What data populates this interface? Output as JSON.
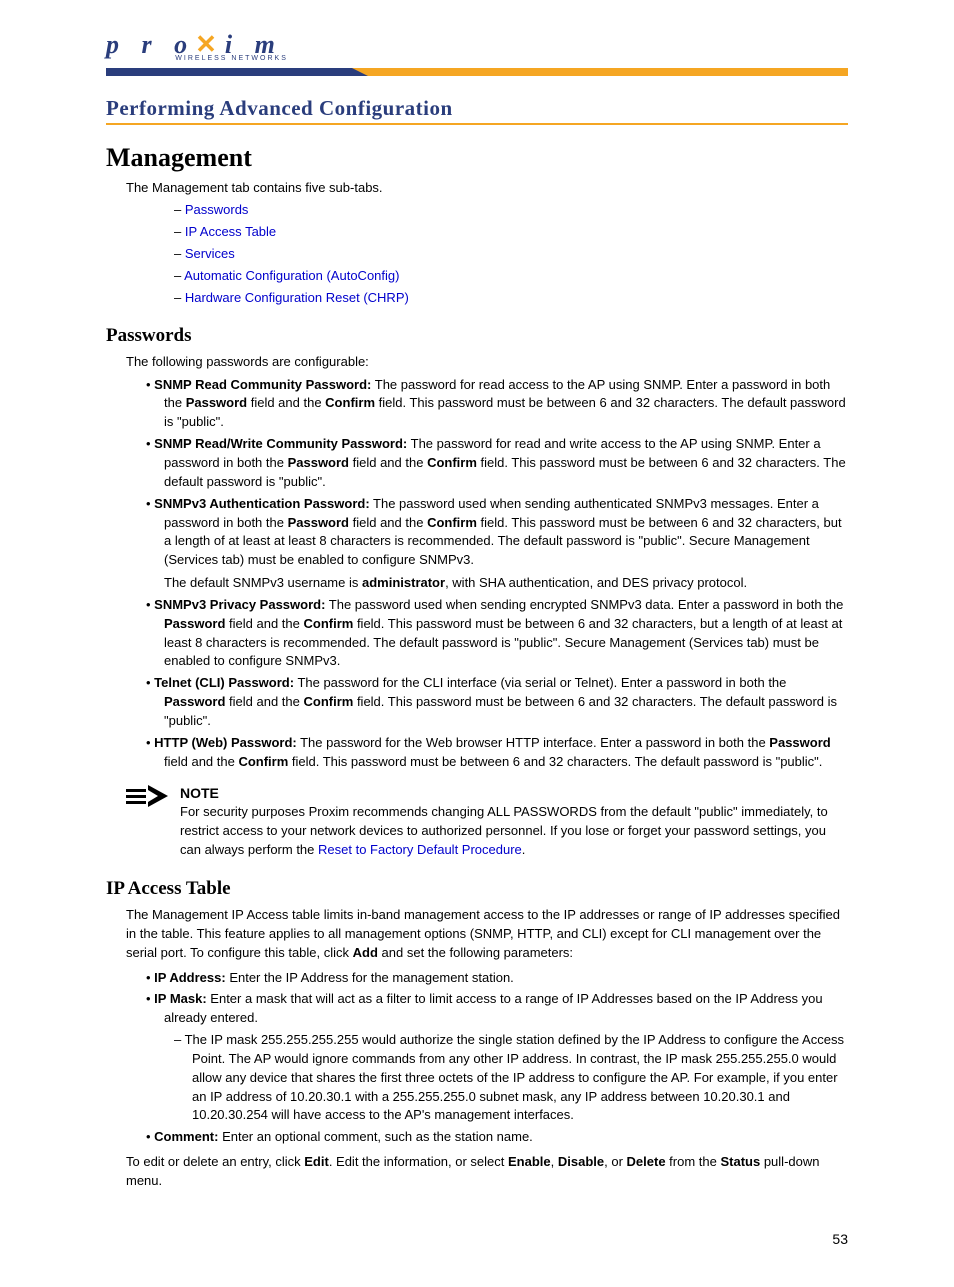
{
  "logo": {
    "text": "proxim",
    "sub": "WIRELESS NETWORKS"
  },
  "section_heading": "Performing Advanced Configuration",
  "main": {
    "title": "Management",
    "intro": "The Management tab contains five sub-tabs.",
    "links": [
      "Passwords",
      "IP Access Table",
      "Services",
      "Automatic Configuration (AutoConfig)",
      "Hardware Configuration Reset (CHRP)"
    ]
  },
  "passwords": {
    "title": "Passwords",
    "intro": "The following passwords are configurable:",
    "items": [
      {
        "bold": "SNMP Read Community Password:",
        "t1": " The password for read access to the AP using SNMP. Enter a password in both the ",
        "b1": "Password",
        "t2": " field and the ",
        "b2": "Confirm",
        "t3": " field. This password must be between 6 and 32 characters. The default password is \"public\"."
      },
      {
        "bold": "SNMP Read/Write Community Password:",
        "t1": " The password for read and write access to the AP using SNMP. Enter a password in both the ",
        "b1": "Password",
        "t2": " field and the ",
        "b2": "Confirm",
        "t3": " field. This password must be between 6 and 32 characters. The default password is \"public\"."
      },
      {
        "bold": "SNMPv3 Authentication Password:",
        "t1": " The password used when sending authenticated SNMPv3 messages. Enter a password in both the ",
        "b1": "Password",
        "t2": " field and the ",
        "b2": "Confirm",
        "t3": " field. This password must be between 6 and 32 characters, but a length of at least at least 8 characters is recommended. The default password is \"public\". Secure Management (Services tab) must be enabled to configure SNMPv3.",
        "extra_pre": "The default SNMPv3 username is ",
        "extra_bold": "administrator",
        "extra_post": ", with SHA authentication, and DES privacy protocol."
      },
      {
        "bold": "SNMPv3 Privacy Password:",
        "t1": " The password used when sending encrypted SNMPv3 data. Enter a password in both the ",
        "b1": "Password",
        "t2": " field and the ",
        "b2": "Confirm",
        "t3": " field. This password must be between 6 and 32 characters, but a length of at least at least 8 characters is recommended. The default password is \"public\". Secure Management (Services tab) must be enabled to configure SNMPv3."
      },
      {
        "bold": "Telnet (CLI) Password:",
        "t1": " The password for the CLI interface (via serial or Telnet). Enter a password in both the ",
        "b1": "Password",
        "t2": " field and the ",
        "b2": "Confirm",
        "t3": " field. This password must be between 6 and 32 characters. The default password is \"public\"."
      },
      {
        "bold": "HTTP (Web) Password:",
        "t1": " The password for the Web browser HTTP interface. Enter a password in both the ",
        "b1": "Password",
        "t2": " field and the ",
        "b2": "Confirm",
        "t3": " field. This password must be between 6 and 32 characters. The default password is \"public\"."
      }
    ]
  },
  "note": {
    "label": "NOTE",
    "pre": "For security purposes Proxim recommends changing ALL PASSWORDS from the default \"public\" immediately, to restrict access to your network devices to authorized personnel. If you lose or forget your password settings, you can always perform the ",
    "link": "Reset to Factory Default Procedure",
    "post": "."
  },
  "ipaccess": {
    "title": "IP Access Table",
    "intro_pre": "The Management IP Access table limits in-band management access to the IP addresses or range of IP addresses specified in the table. This feature applies to all management options (SNMP, HTTP, and CLI) except for CLI management over the serial port. To configure this table, click ",
    "intro_bold": "Add",
    "intro_post": " and set the following parameters:",
    "items": [
      {
        "bold": "IP Address:",
        "text": " Enter the IP Address for the management station."
      },
      {
        "bold": "IP Mask:",
        "text": " Enter a mask that will act as a filter to limit access to a range of IP Addresses based on the IP Address you already entered."
      }
    ],
    "mask_detail": "The IP mask 255.255.255.255 would authorize the single station defined by the IP Address to configure the Access Point. The AP would ignore commands from any other IP address. In contrast, the IP mask 255.255.255.0 would allow any device that shares the first three octets of the IP address to configure the AP. For example, if you enter an IP address of 10.20.30.1 with a 255.255.255.0 subnet mask, any IP address between 10.20.30.1 and 10.20.30.254 will have access to the AP's management interfaces.",
    "comment": {
      "bold": "Comment:",
      "text": " Enter an optional comment, such as the station name."
    },
    "edit_p1": "To edit or delete an entry, click ",
    "edit_b1": "Edit",
    "edit_p2": ". Edit the information, or select ",
    "edit_b2": "Enable",
    "edit_p3": ", ",
    "edit_b3": "Disable",
    "edit_p4": ", or ",
    "edit_b4": "Delete",
    "edit_p5": " from the ",
    "edit_b5": "Status",
    "edit_p6": " pull-down menu."
  },
  "page_number": "53"
}
